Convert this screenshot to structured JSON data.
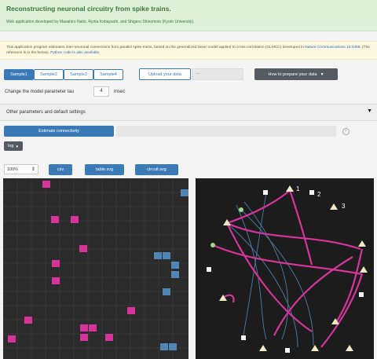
{
  "header": {
    "title": "Reconstructing neuronal circuitry from spike trains.",
    "subtitle": "Web application developed by Masahiro Naito, Ryota Kobayashi, and Shigeru Shinomoto (Kyoto University)."
  },
  "info": {
    "text": "This application program estimates inter-neuronal connections from parallel spike trains, based on the generalized linear model applied to cross-correlation (GLMCC) developed in",
    "link_text": "Nature Communications 10:4468.",
    "text2": "(The reference is in the below).",
    "link2_text": "Python code is also available."
  },
  "toolbar": {
    "tabs": [
      {
        "label": "Sample1",
        "active": true
      },
      {
        "label": "Sample2",
        "active": false
      },
      {
        "label": "Sample3",
        "active": false
      },
      {
        "label": "Sample4",
        "active": false
      }
    ],
    "upload_label": "Upload your data",
    "file_path": "...",
    "howto_label": "How to prepare your data"
  },
  "params": {
    "tau_label": "Change the model parameter tau",
    "tau_value": "4",
    "tau_unit": "msec",
    "other_label": "Other parameters and default settings"
  },
  "estimate": {
    "button_label": "Estimate connectivity",
    "progress": 0,
    "log_label": "log"
  },
  "outputs": {
    "zoom_value": "100%",
    "csv_label": "csv",
    "table_label": "table.svg",
    "circuit_label": "circuit.svg"
  },
  "colors": {
    "excitatory": "#d6349b",
    "inhibitory": "#4f86b5",
    "accent": "#3a7ab7"
  },
  "network": {
    "labels": [
      "1",
      "2",
      "3"
    ]
  }
}
